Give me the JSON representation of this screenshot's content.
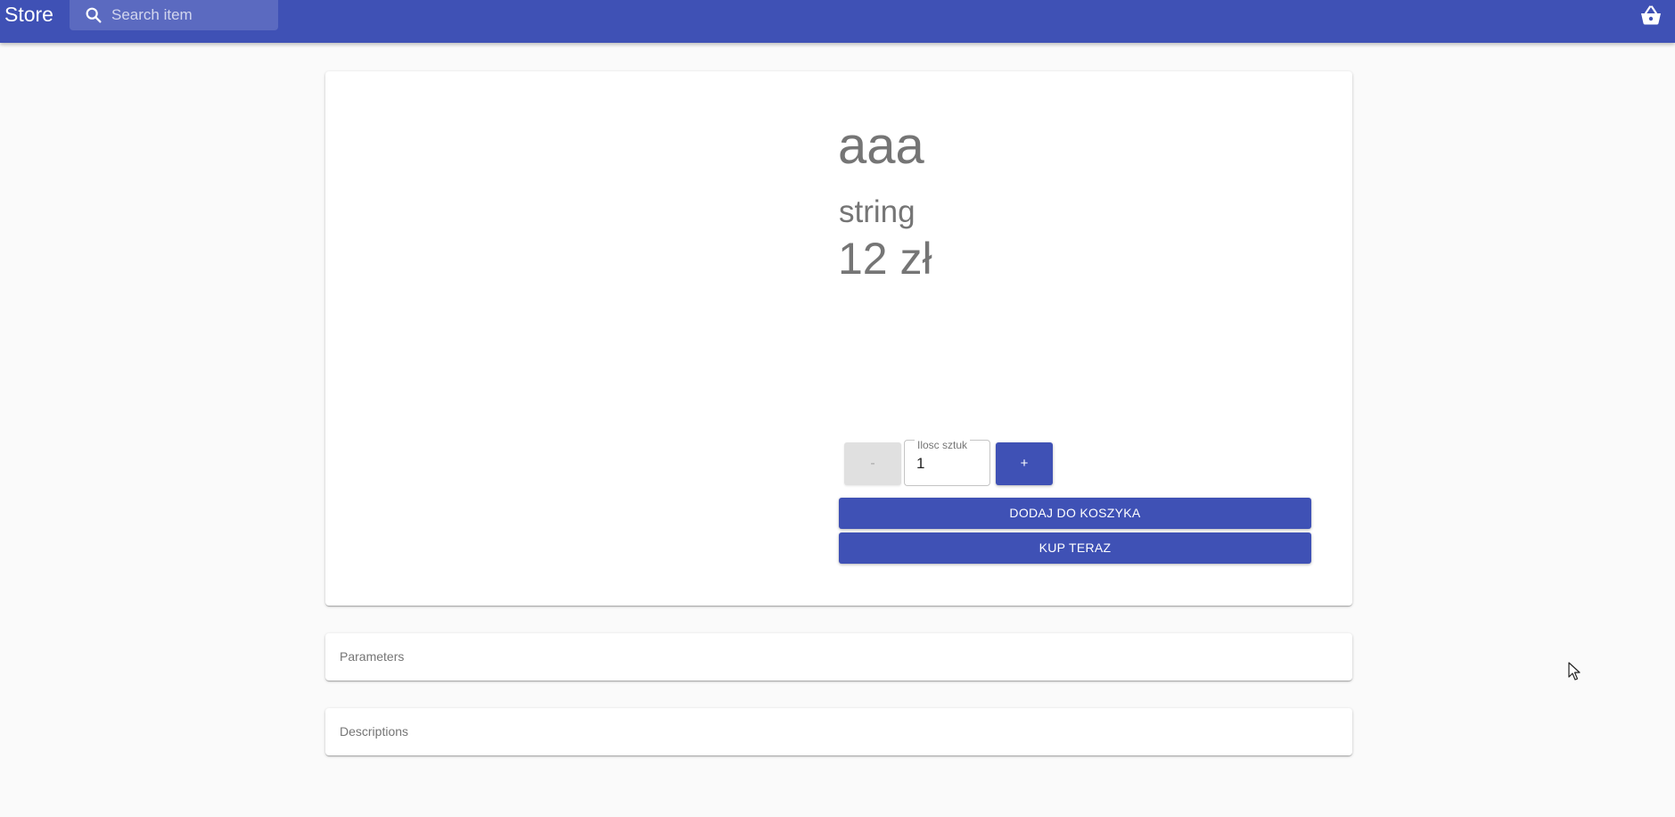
{
  "header": {
    "brand": "Store",
    "search": {
      "placeholder": "Search item",
      "value": "",
      "icon": "search-icon"
    },
    "cart_icon": "shopping-basket-icon",
    "color": "#3f51b5"
  },
  "product": {
    "name": "aaa",
    "subtitle": "string",
    "price": "12 zł"
  },
  "quantity": {
    "decrement_label": "-",
    "label": "Ilosc sztuk",
    "value": "1",
    "increment_label": "+"
  },
  "actions": {
    "add_to_cart": "DODAJ DO KOSZYKA",
    "buy_now": "KUP TERAZ"
  },
  "sections": {
    "parameters": "Parameters",
    "descriptions": "Descriptions"
  }
}
